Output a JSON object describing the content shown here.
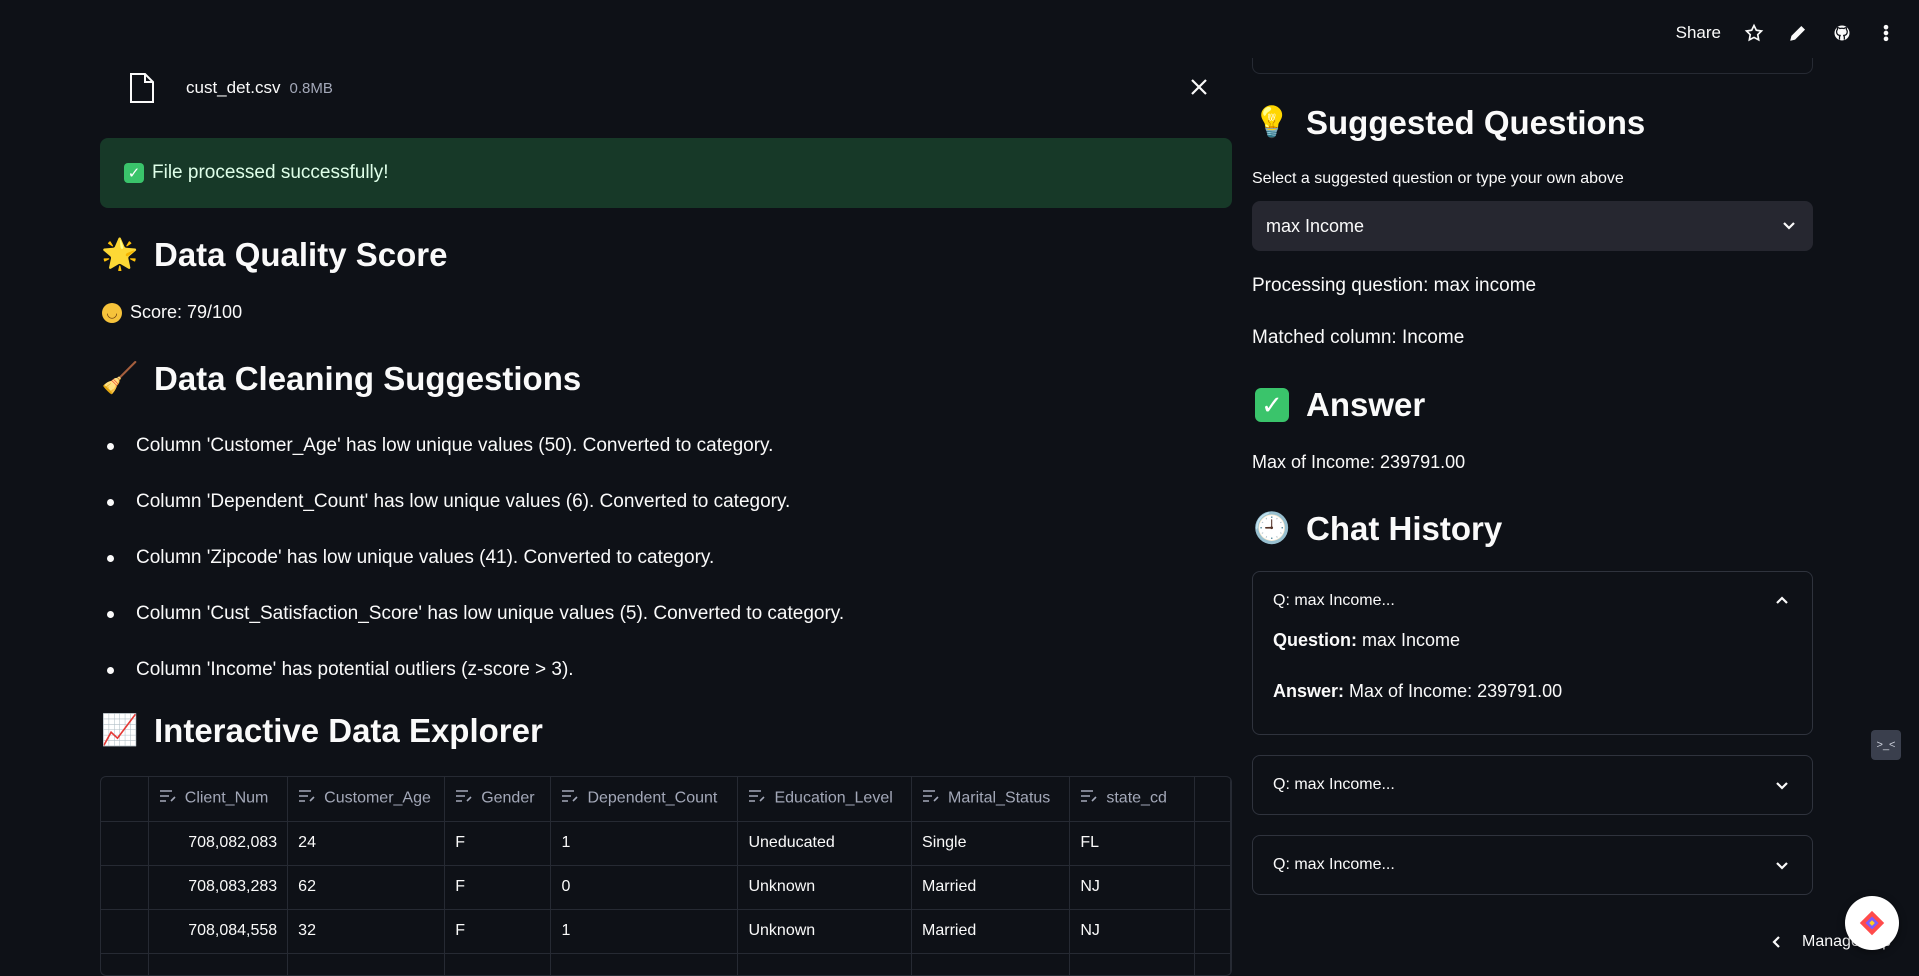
{
  "toolbar": {
    "share_label": "Share",
    "icons": [
      "star-icon",
      "pencil-icon",
      "github-icon",
      "more-vertical-icon"
    ]
  },
  "upload": {
    "file_name": "cust_det.csv",
    "file_size": "0.8MB",
    "icon": "file-icon"
  },
  "success_message": "File processed successfully!",
  "quality": {
    "title": "Data Quality Score",
    "emoji": "🌟",
    "score_text": "Score: 79/100"
  },
  "cleaning": {
    "title": "Data Cleaning Suggestions",
    "emoji": "🧹",
    "items": [
      "Column 'Customer_Age' has low unique values (50). Converted to category.",
      "Column 'Dependent_Count' has low unique values (6). Converted to category.",
      "Column 'Zipcode' has low unique values (41). Converted to category.",
      "Column 'Cust_Satisfaction_Score' has low unique values (5). Converted to category.",
      "Column 'Income' has potential outliers (z-score > 3)."
    ]
  },
  "explorer": {
    "title": "Interactive Data Explorer",
    "emoji": "📈",
    "columns": [
      "Client_Num",
      "Customer_Age",
      "Gender",
      "Dependent_Count",
      "Education_Level",
      "Marital_Status",
      "state_cd"
    ],
    "rows": [
      [
        "708,082,083",
        "24",
        "F",
        "1",
        "Uneducated",
        "Single",
        "FL"
      ],
      [
        "708,083,283",
        "62",
        "F",
        "0",
        "Unknown",
        "Married",
        "NJ"
      ],
      [
        "708,084,558",
        "32",
        "F",
        "1",
        "Unknown",
        "Married",
        "NJ"
      ]
    ]
  },
  "suggested": {
    "title": "Suggested Questions",
    "emoji": "💡",
    "select_label": "Select a suggested question or type your own above",
    "selected": "max Income",
    "processing": "Processing question: max income",
    "matched": "Matched column: Income"
  },
  "answer": {
    "title": "Answer",
    "text": "Max of Income: 239791.00"
  },
  "history": {
    "title": "Chat History",
    "emoji": "🕘",
    "items": [
      {
        "header": "Q: max Income...",
        "question_label": "Question:",
        "question": "max Income",
        "answer_label": "Answer:",
        "answer": "Max of Income: 239791.00",
        "expanded": true
      },
      {
        "header": "Q: max Income...",
        "expanded": false
      },
      {
        "header": "Q: max Income...",
        "expanded": false
      }
    ]
  },
  "footer": {
    "manage_label": "Manage app"
  }
}
